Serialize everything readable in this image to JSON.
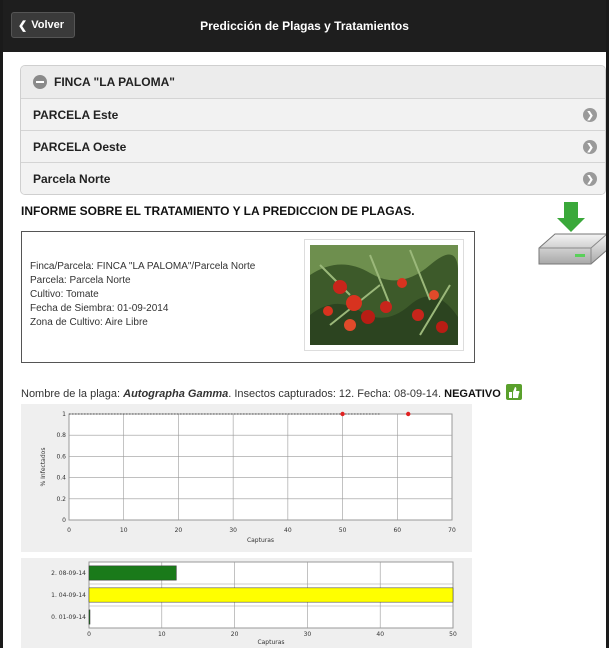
{
  "header": {
    "back_label": "Volver",
    "title": "Predicción de Plagas y Tratamientos"
  },
  "list": {
    "group_label": "FINCA \"LA PALOMA\"",
    "items": [
      {
        "label": "PARCELA Este"
      },
      {
        "label": "PARCELA Oeste"
      },
      {
        "label": "Parcela Norte"
      }
    ]
  },
  "report": {
    "heading": "INFORME SOBRE EL TRATAMIENTO Y LA PREDICCION DE PLAGAS.",
    "lines": [
      "Finca/Parcela: FINCA \"LA PALOMA\"/Parcela Norte",
      "Parcela: Parcela Norte",
      "Cultivo: Tomate",
      "Fecha de Siembra: 01-09-2014",
      "Zona de Cultivo: Aire Libre"
    ]
  },
  "plaga": {
    "prefix": "Nombre de la plaga: ",
    "name": "Autographa Gamma",
    "details": ". Insectos capturados: 12. Fecha: 08-09-14. ",
    "result": "NEGATIVO"
  },
  "chart_data": [
    {
      "type": "scatter",
      "xlabel": "Capturas",
      "ylabel": "% Infectados",
      "xlim": [
        0,
        70
      ],
      "ylim": [
        0,
        1
      ],
      "xticks": [
        "0",
        "10",
        "20",
        "30",
        "40",
        "50",
        "60",
        "70"
      ],
      "yticks": [
        "0",
        "0.2",
        "0.4",
        "0.6",
        "0.8",
        "1"
      ],
      "dotted_line": {
        "x": [
          0,
          57
        ],
        "y": [
          1,
          1
        ]
      },
      "points": [
        {
          "x": 50,
          "y": 1
        },
        {
          "x": 62,
          "y": 1
        }
      ],
      "point_color": "#e02020",
      "grid": true
    },
    {
      "type": "bar",
      "orientation": "horizontal",
      "xlabel": "Capturas",
      "xlim": [
        0,
        50
      ],
      "xticks": [
        "0",
        "10",
        "20",
        "30",
        "40",
        "50"
      ],
      "categories": [
        "0. 01-09-14",
        "1. 04-09-14",
        "2. 08-09-14"
      ],
      "values": [
        0,
        50,
        12
      ],
      "colors": [
        "#1a7a1a",
        "#ffff00",
        "#1a7a1a"
      ],
      "grid": true
    }
  ]
}
